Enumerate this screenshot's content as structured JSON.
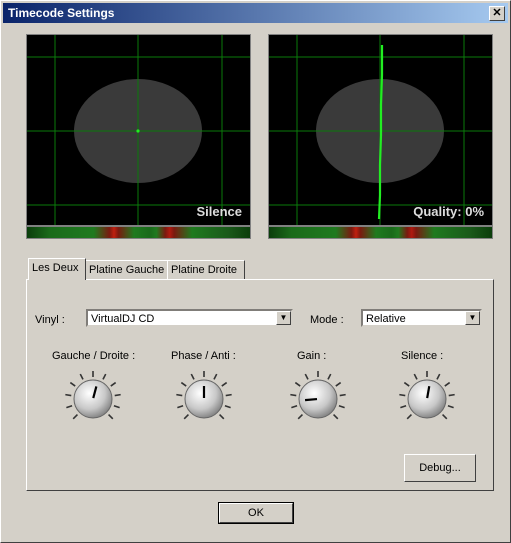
{
  "window": {
    "title": "Timecode Settings",
    "close_label": "✕"
  },
  "scopes": [
    {
      "label": "Silence",
      "signal": "dot"
    },
    {
      "label": "Quality: 0%",
      "signal": "vertical-line"
    }
  ],
  "tabs": [
    "Les Deux",
    "Platine Gauche",
    "Platine Droite"
  ],
  "active_tab": 0,
  "vinyl": {
    "label": "Vinyl :",
    "value": "VirtualDJ CD"
  },
  "mode": {
    "label": "Mode :",
    "value": "Relative"
  },
  "knobs": [
    {
      "label": "Gauche / Droite :",
      "angle": 15
    },
    {
      "label": "Phase / Anti :",
      "angle": 0
    },
    {
      "label": "Gain :",
      "angle": -95
    },
    {
      "label": "Silence :",
      "angle": 10
    }
  ],
  "debug_label": "Debug...",
  "ok_label": "OK",
  "colors": {
    "title_start": "#0a246a",
    "title_end": "#a6caf0",
    "grid": "#0a8a0a",
    "signal": "#22ee22",
    "face": "#d4d0c8"
  }
}
